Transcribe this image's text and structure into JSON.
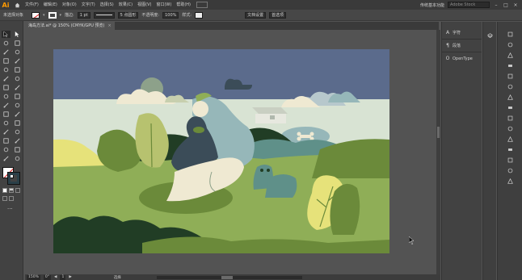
{
  "app": {
    "logo": "Ai",
    "menu": [
      "文件(F)",
      "编辑(E)",
      "对象(O)",
      "文字(T)",
      "选择(S)",
      "效果(C)",
      "视图(V)",
      "窗口(W)",
      "帮助(H)"
    ],
    "workspace": "传统基本功能",
    "search_placeholder": "Adobe Stock"
  },
  "control_bar": {
    "selection_label": "未选择对象",
    "stroke_label": "描边:",
    "stroke_width": "1 pt",
    "stroke_style": "基本",
    "brush_label": "5 点圆形",
    "opacity_label": "不透明度:",
    "opacity_value": "100%",
    "style_label": "样式:",
    "doc_settings": "文档设置",
    "prefs": "首选项"
  },
  "document": {
    "tab_title": "海岛方法.ai* @ 150% (CMYK/GPU 预览)",
    "close": "×"
  },
  "status_bar": {
    "zoom": "150%",
    "rotate": "0°",
    "page": "1",
    "tool": "选择"
  },
  "panels": [
    {
      "icon": "type-icon",
      "glyph": "A",
      "label": "字符"
    },
    {
      "icon": "paragraph-icon",
      "glyph": "¶",
      "label": "段落"
    },
    {
      "icon": "opentype-icon",
      "glyph": "O",
      "label": "OpenType"
    }
  ],
  "artwork": {
    "colors": {
      "sky": "#5b6b8c",
      "haze": "#d8e3d3",
      "meadow": "#8fae57",
      "dark_green": "#213d25",
      "olive": "#6b8a3a",
      "yellow": "#e6e27a",
      "teal": "#5f9089",
      "slate": "#3b4c58",
      "pale_blue": "#96b7b9",
      "cream": "#efe9d2"
    }
  },
  "toolbar_tools": [
    "selection-tool",
    "direct-selection-tool",
    "magic-wand-tool",
    "lasso-tool",
    "pen-tool",
    "curvature-tool",
    "type-tool",
    "line-tool",
    "rectangle-tool",
    "paintbrush-tool",
    "shaper-tool",
    "pencil-tool",
    "eraser-tool",
    "rotate-tool",
    "scale-tool",
    "width-tool",
    "free-transform-tool",
    "shape-builder-tool",
    "perspective-tool",
    "mesh-tool",
    "gradient-tool",
    "eyedropper-tool",
    "blend-tool",
    "symbol-sprayer-tool",
    "column-graph-tool",
    "artboard-tool",
    "slice-tool",
    "hand-tool",
    "zoom-tool",
    "none-tool"
  ]
}
